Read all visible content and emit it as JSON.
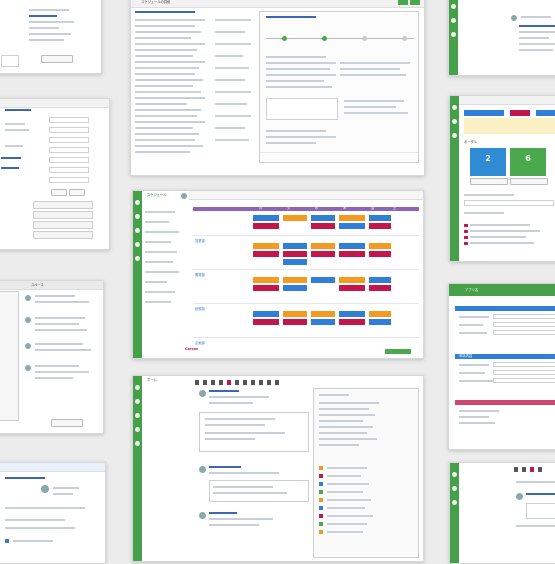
{
  "sched": {
    "title": "スケジュール",
    "days": [
      "月",
      "火",
      "水",
      "木",
      "金",
      "土",
      "日"
    ],
    "logo": "Garoon",
    "groups": [
      "営業部",
      "開発部",
      "総務部",
      "企画部"
    ]
  },
  "detail": {
    "title": "スケジュールの詳細",
    "steps": [
      "申請",
      "承認",
      "確認",
      "完了"
    ]
  },
  "portal": {
    "header": "ポータル",
    "counts": [
      "2",
      "6"
    ]
  },
  "app": {
    "title": "アプリ名",
    "section": "申請内容"
  },
  "login": {
    "title": "ログイン",
    "ok": "OK"
  },
  "chat": {
    "title": "スペース"
  },
  "feed": {
    "title": "ホーム"
  },
  "colors": {
    "green": "#46a04a",
    "orange": "#f39a21",
    "blue": "#2f7fd8",
    "crimson": "#c3164b"
  }
}
